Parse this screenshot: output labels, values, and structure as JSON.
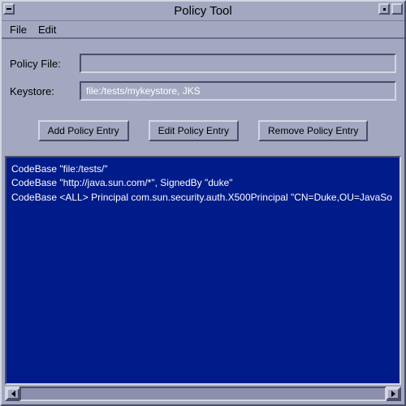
{
  "window": {
    "title": "Policy Tool"
  },
  "menubar": {
    "items": [
      "File",
      "Edit"
    ]
  },
  "fields": {
    "policy_file": {
      "label": "Policy File:",
      "value": ""
    },
    "keystore": {
      "label": "Keystore:",
      "value": "file:/tests/mykeystore, JKS"
    }
  },
  "buttons": {
    "add": "Add Policy Entry",
    "edit": "Edit Policy Entry",
    "remove": "Remove Policy Entry"
  },
  "policy_list": [
    "CodeBase \"file:/tests/\"",
    "CodeBase \"http://java.sun.com/*\", SignedBy \"duke\"",
    "CodeBase <ALL>  Principal com.sun.security.auth.X500Principal \"CN=Duke,OU=JavaSo"
  ],
  "colors": {
    "panel": "#a3a8c0",
    "list_bg": "#001b8a",
    "list_fg": "#ffffff"
  }
}
